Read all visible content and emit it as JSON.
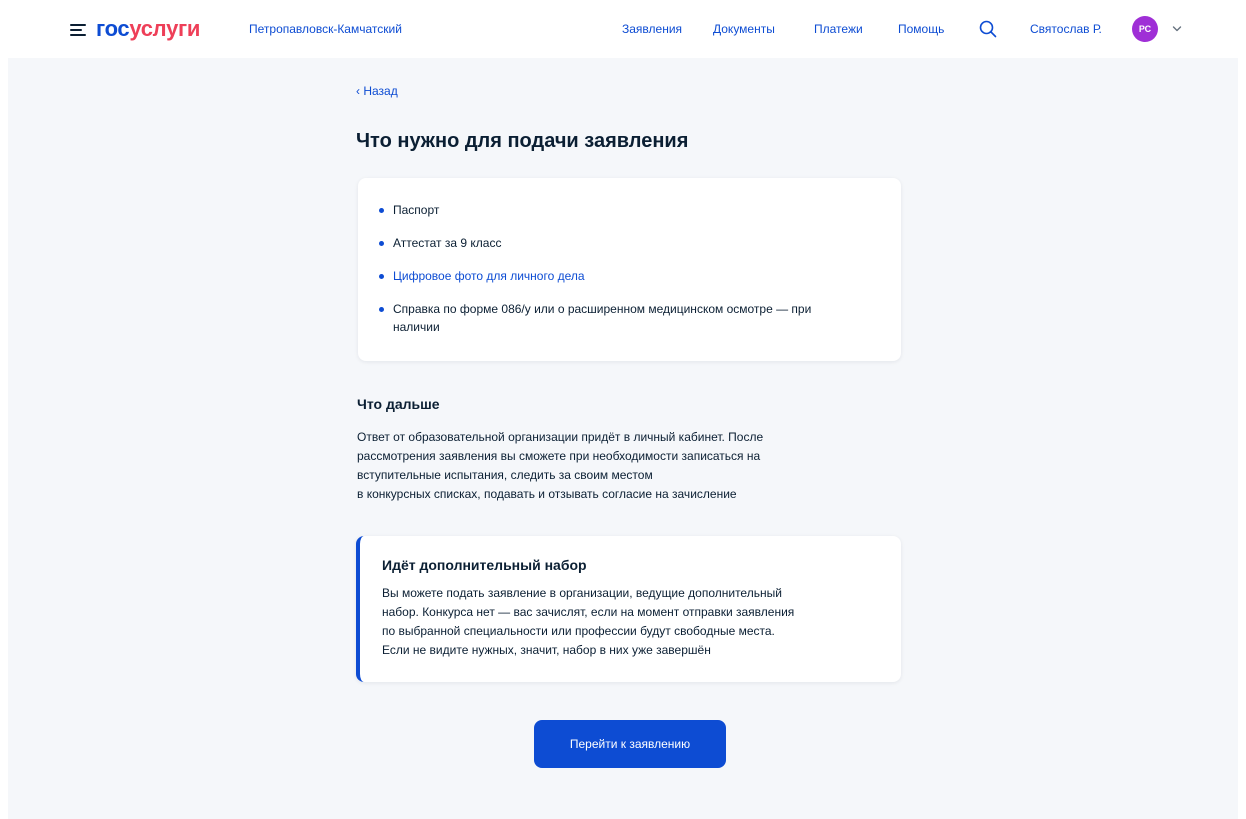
{
  "header": {
    "logo_part1": "гос",
    "logo_part2": "услуги",
    "region": "Петропавловск-Камчатский",
    "nav": [
      "Заявления",
      "Документы",
      "Платежи",
      "Помощь"
    ],
    "user_name": "Святослав Р.",
    "avatar_initials": "РС",
    "icons": {
      "menu": "hamburger-menu-icon",
      "search": "search-icon",
      "chevron": "chevron-down-icon"
    }
  },
  "main": {
    "back_label": "‹ Назад",
    "title": "Что нужно для подачи заявления",
    "requirements": [
      {
        "text": "Паспорт",
        "is_link": false
      },
      {
        "text": "Аттестат за 9 класс",
        "is_link": false
      },
      {
        "text": "Цифровое фото для личного дела",
        "is_link": true
      },
      {
        "text": "Справка по форме 086/у или о расширенном медицинском осмотре — при наличии",
        "is_link": false
      }
    ],
    "next_title": "Что дальше",
    "next_lines": [
      "Ответ от образовательной организации придёт в личный кабинет. После",
      "рассмотрения заявления вы сможете при необходимости записаться на",
      "вступительные испытания, следить за своим местом",
      "в конкурсных списках, подавать и отзывать согласие на зачисление"
    ],
    "notice": {
      "title": "Идёт дополнительный набор",
      "lines": [
        "Вы можете подать заявление в организации, ведущие дополнительный",
        "набор. Конкурса нет — вас зачислят, если на момент отправки заявления",
        "по выбранной специальности или профессии будут свободные места.",
        "Если не видите нужных, значит, набор в них уже завершён"
      ]
    },
    "cta_label": "Перейти к заявлению"
  },
  "colors": {
    "accent": "#0d4cd3",
    "brand_red": "#ee3f58",
    "avatar": "#9f2fd6",
    "page_bg": "#f5f7fa"
  }
}
